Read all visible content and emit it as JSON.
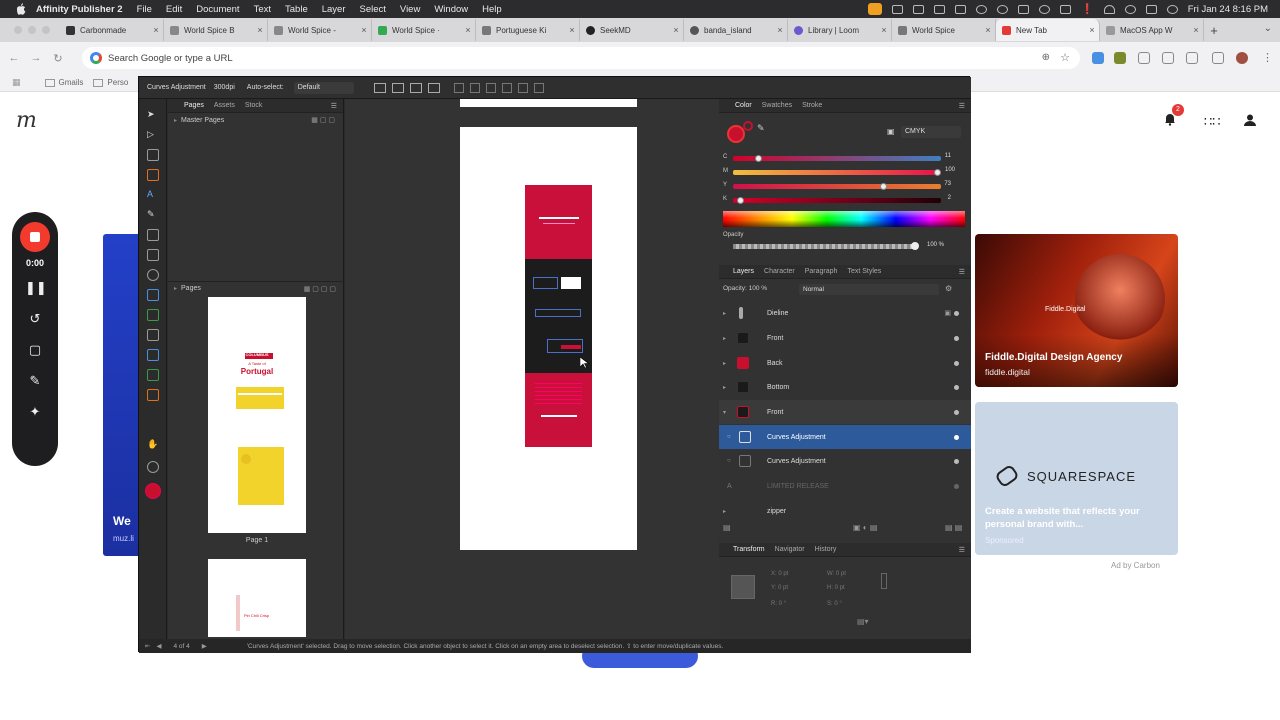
{
  "menubar": {
    "app": "Affinity Publisher 2",
    "items": [
      "File",
      "Edit",
      "Document",
      "Text",
      "Table",
      "Layer",
      "Select",
      "View",
      "Window",
      "Help"
    ],
    "clock": "Fri Jan 24  8:16 PM"
  },
  "browser": {
    "tabs": [
      {
        "label": "Carbonmade",
        "color": "#333333"
      },
      {
        "label": "World Spice B",
        "color": "#888888"
      },
      {
        "label": "World Spice -",
        "color": "#888888"
      },
      {
        "label": "World Spice ·",
        "color": "#34a853"
      },
      {
        "label": "Portuguese Ki",
        "color": "#777777"
      },
      {
        "label": "SeekMD",
        "color": "#222222"
      },
      {
        "label": "banda_island",
        "color": "#555555"
      },
      {
        "label": "Library | Loom",
        "color": "#6a5acd"
      },
      {
        "label": "World Spice",
        "color": "#777777"
      },
      {
        "label": "New Tab",
        "color": "#e53935",
        "active": true
      },
      {
        "label": "MacOS App W",
        "color": "#999999"
      }
    ],
    "address_placeholder": "Search Google or type a URL",
    "bookmarks": [
      "Gmails",
      "Perso"
    ]
  },
  "newtab": {
    "logo": "m",
    "promo_left": "We",
    "promo_left_sub": "muz.li",
    "card1_title": "Fiddle.Digital Design Agency",
    "card1_url": "fiddle.digital",
    "card1_logo": "Fiddle.Digital",
    "card2_brand": "SQUARESPACE",
    "card2_text": "Create a website that reflects your personal brand with...",
    "card2_sponsored": "Sponsored",
    "ad_by": "Ad by Carbon",
    "notif_count": "2"
  },
  "recorder": {
    "time": "0:00"
  },
  "publisher": {
    "context_label": "Curves Adjustment",
    "dpi": "300dpi",
    "auto_select": "Auto-select:",
    "auto_select_value": "Default",
    "left_tabs": [
      "Pages",
      "Assets",
      "Stock"
    ],
    "master_pages": "Master Pages",
    "pages_label": "Pages",
    "page_caption": "Page 1",
    "thumb_title1": "COLUMBUS",
    "thumb_title2": "A Taste of",
    "thumb_title3": "Portugal",
    "thumb_bottom": "Piri Chili Crisp",
    "page_counter": "4 of 4",
    "color_tabs": [
      "Color",
      "Swatches",
      "Stroke"
    ],
    "color_mode": "CMYK",
    "cmyk": [
      {
        "ch": "C",
        "value": "11",
        "fraction": 0.11
      },
      {
        "ch": "M",
        "value": "100",
        "fraction": 1.0
      },
      {
        "ch": "Y",
        "value": "73",
        "fraction": 0.73
      },
      {
        "ch": "K",
        "value": "2",
        "fraction": 0.02
      }
    ],
    "opacity_label": "Opacity",
    "opacity_value": "100 %",
    "layer_tabs": [
      "Layers",
      "Character",
      "Paragraph",
      "Text Styles"
    ],
    "layer_opacity": "Opacity: 100 %",
    "blend_mode": "Normal",
    "layers": [
      {
        "name": "Dieline",
        "selected": false
      },
      {
        "name": "Front",
        "selected": false
      },
      {
        "name": "Back",
        "selected": false
      },
      {
        "name": "Bottom",
        "selected": false
      },
      {
        "name": "Front",
        "selected": false
      },
      {
        "name": "Curves Adjustment",
        "selected": true
      },
      {
        "name": "Curves Adjustment",
        "selected": false
      },
      {
        "name": "LIMITED RELEASE",
        "selected": false,
        "dim": true
      },
      {
        "name": "zipper",
        "selected": false
      }
    ],
    "transform_tabs": [
      "Transform",
      "Navigator",
      "History"
    ],
    "transform": {
      "x": "X: 0 pt",
      "y": "Y: 0 pt",
      "w": "W: 0 pt",
      "h": "H: 0 pt",
      "r": "R: 0 °",
      "s": "S: 0 °"
    },
    "status_text": "'Curves Adjustment' selected. Drag to move selection. Click another object to select it. Click on an empty area to deselect selection. ⇧ to enter move/duplicate values."
  }
}
